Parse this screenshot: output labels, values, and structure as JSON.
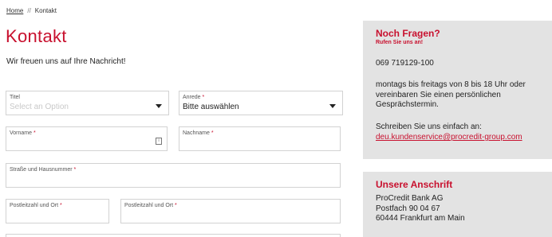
{
  "breadcrumb": {
    "home": "Home",
    "separator": "//",
    "current": "Kontakt"
  },
  "page": {
    "title": "Kontakt",
    "intro": "Wir freuen uns auf Ihre Nachricht!"
  },
  "form": {
    "required_mark": "*",
    "titel": {
      "label": "Titel",
      "placeholder": "Select an Option"
    },
    "anrede": {
      "label": "Anrede",
      "value": "Bitte auswählen"
    },
    "vorname": {
      "label": "Vorname",
      "icon": "contact-card-icon"
    },
    "nachname": {
      "label": "Nachname"
    },
    "strasse": {
      "label": "Straße und Hausnummer"
    },
    "plz1": {
      "label": "Postleitzahl und Ort"
    },
    "plz2": {
      "label": "Postleitzahl und Ort"
    }
  },
  "sidebar": {
    "questions": {
      "title": "Noch Fragen?",
      "subtitle": "Rufen Sie uns an!",
      "phone": "069 719129-100",
      "hours": [
        "montags bis freitags von 8 bis 18 Uhr oder",
        "vereinbaren Sie einen persönlichen",
        "Gesprächstermin."
      ],
      "write_text": "Schreiben Sie uns einfach an:",
      "email": "deu.kundenservice@procredit-group.com"
    },
    "address": {
      "title": "Unsere Anschrift",
      "lines": [
        "ProCredit Bank AG",
        "Postfach 90 04 67",
        "60444 Frankfurt am Main"
      ]
    }
  },
  "colors": {
    "accent": "#c8102e",
    "sidebar_bg": "#e3e3e3",
    "border": "#d2d2d2"
  }
}
